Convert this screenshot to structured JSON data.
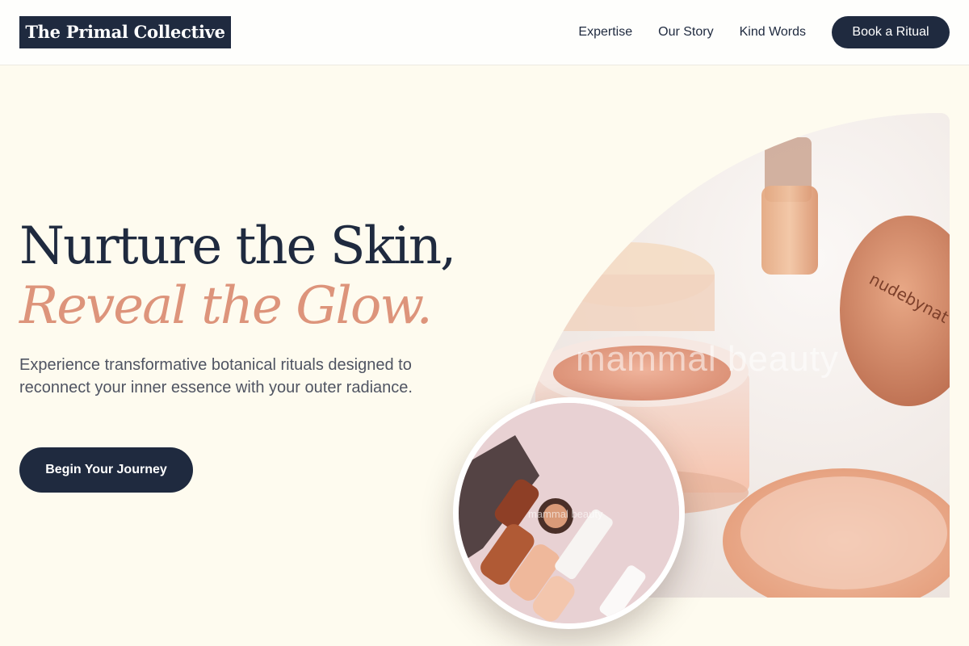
{
  "header": {
    "logo": "The Primal Collective",
    "nav": [
      {
        "label": "Expertise"
      },
      {
        "label": "Our Story"
      },
      {
        "label": "Kind Words"
      }
    ],
    "cta_label": "Book a Ritual"
  },
  "hero": {
    "title_line1": "Nurture the Skin,",
    "title_line2": "Reveal the Glow.",
    "subtitle": "Experience transformative botanical rituals designed to reconnect your inner essence with your outer radiance.",
    "cta_label": "Begin Your Journey",
    "image_watermark": "mammal beauty",
    "jar_lid_text": "nudebynat",
    "inset_watermark": "mammal beauty"
  },
  "colors": {
    "navy": "#1f2a3f",
    "accent": "#dd947b",
    "background": "#fefbef"
  },
  "icons": []
}
